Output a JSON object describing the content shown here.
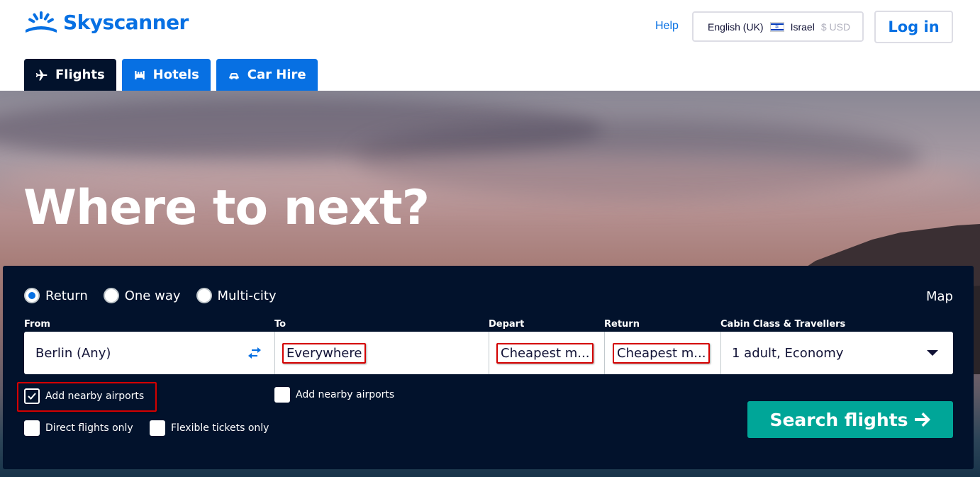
{
  "header": {
    "logo_text": "Skyscanner",
    "help_label": "Help",
    "locale": {
      "language": "English (UK)",
      "country": "Israel",
      "currency": "$ USD"
    },
    "login_label": "Log in"
  },
  "tabs": [
    {
      "label": "Flights",
      "icon": "plane-icon",
      "active": true
    },
    {
      "label": "Hotels",
      "icon": "bed-icon",
      "active": false
    },
    {
      "label": "Car Hire",
      "icon": "car-icon",
      "active": false
    }
  ],
  "hero": {
    "title": "Where to next?"
  },
  "search": {
    "trip_types": [
      {
        "label": "Return",
        "checked": true
      },
      {
        "label": "One way",
        "checked": false
      },
      {
        "label": "Multi-city",
        "checked": false
      }
    ],
    "map_label": "Map",
    "labels": {
      "from": "From",
      "to": "To",
      "depart": "Depart",
      "return": "Return",
      "cabin": "Cabin Class & Travellers"
    },
    "values": {
      "from": "Berlin (Any)",
      "to": "Everywhere",
      "depart": "Cheapest m...",
      "return": "Cheapest m...",
      "cabin": "1 adult, Economy"
    },
    "checkboxes": {
      "nearby_from": {
        "label": "Add nearby airports",
        "checked": true
      },
      "nearby_to": {
        "label": "Add nearby airports",
        "checked": false
      },
      "direct": {
        "label": "Direct flights only",
        "checked": false
      },
      "flexible": {
        "label": "Flexible tickets only",
        "checked": false
      }
    },
    "submit_label": "Search flights"
  },
  "colors": {
    "brand_blue": "#0770e3",
    "panel_navy": "#02122c",
    "search_green": "#00a698",
    "highlight_red": "#d40000"
  }
}
